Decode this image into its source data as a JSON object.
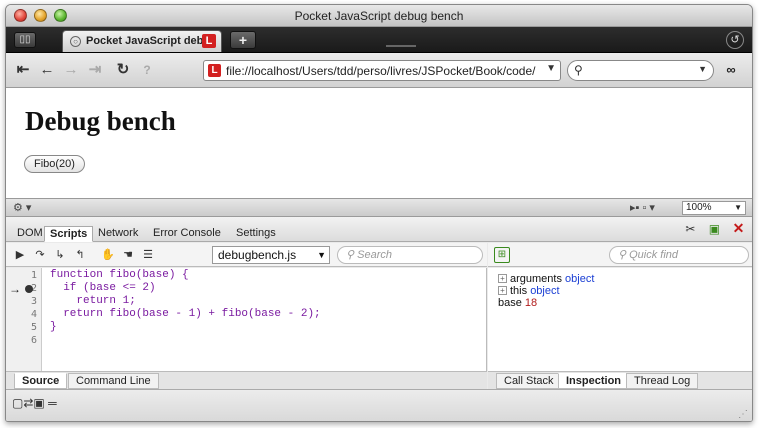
{
  "window": {
    "title": "Pocket JavaScript debug bench"
  },
  "tabs": [
    {
      "label": "Pocket JavaScript deb..."
    }
  ],
  "tabstrip": {
    "tab_list_icon": "▯▯",
    "new_tab": "+"
  },
  "nav": {
    "address": "file://localhost/Users/tdd/perso/livres/JSPocket/Book/code/c",
    "search_placeholder": ""
  },
  "page": {
    "heading": "Debug bench",
    "button_label": "Fibo(20)"
  },
  "status": {
    "zoom": "100%"
  },
  "devtools": {
    "tabs": [
      "DOM",
      "Scripts",
      "Network",
      "Error Console",
      "Settings"
    ],
    "active_tab": "Scripts",
    "script_file": "debugbench.js",
    "search_placeholder": "Search",
    "quick_find_placeholder": "Quick find",
    "line_numbers": [
      "1",
      "2",
      "3",
      "4",
      "5",
      "6"
    ],
    "code_lines": [
      "function fibo(base) {",
      "  if (base <= 2)",
      "    return 1;",
      "  return fibo(base - 1) + fibo(base - 2);",
      "}",
      ""
    ],
    "inspection": {
      "arguments_label": "arguments",
      "arguments_type": "object",
      "this_label": "this",
      "this_type": "object",
      "base_label": "base",
      "base_value": "18"
    },
    "left_bottom_tabs": [
      "Source",
      "Command Line"
    ],
    "right_bottom_tabs": [
      "Call Stack",
      "Inspection",
      "Thread Log"
    ]
  },
  "colors": {
    "keyword": "#1a3ed4",
    "string_purple": "#7a1aa0",
    "value_red": "#b01a1a",
    "badge_red": "#d32020"
  }
}
